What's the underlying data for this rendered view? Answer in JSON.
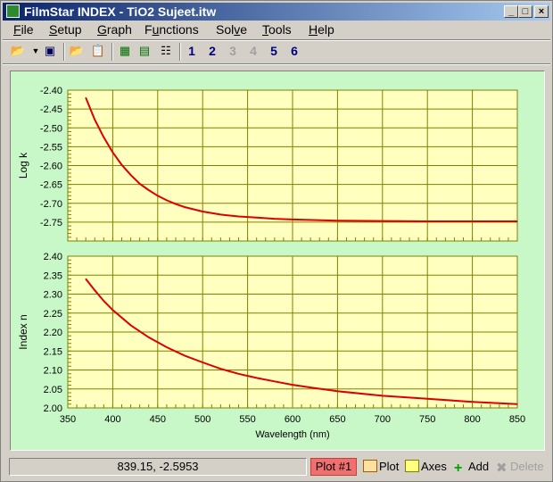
{
  "window": {
    "title": "FilmStar INDEX - TiO2 Sujeet.itw"
  },
  "menu": [
    "File",
    "Setup",
    "Graph",
    "Functions",
    "Solve",
    "Tools",
    "Help"
  ],
  "menu_underline": [
    "F",
    "S",
    "G",
    "u",
    "v",
    "T",
    "H"
  ],
  "toolbar": {
    "numbers": [
      "1",
      "2",
      "3",
      "4",
      "5",
      "6"
    ],
    "disabled_numbers": [
      "3",
      "4"
    ]
  },
  "status": {
    "coords": "839.15, -2.5953",
    "plot_badge": "Plot #1",
    "plot_label": "Plot",
    "axes_label": "Axes",
    "add_label": "Add",
    "delete_label": "Delete"
  },
  "colors": {
    "plot_bg": "#ffffc0",
    "grid": "#808000",
    "curve": "#dd0000",
    "frame_bg": "#c8f8c8"
  },
  "chart_data": [
    {
      "type": "line",
      "ylabel": "Log k",
      "xlim": [
        350,
        850
      ],
      "ylim": [
        -2.8,
        -2.4
      ],
      "yticks": [
        "-2.40",
        "-2.45",
        "-2.50",
        "-2.55",
        "-2.60",
        "-2.65",
        "-2.70",
        "-2.75"
      ],
      "x": [
        370,
        380,
        390,
        400,
        410,
        420,
        430,
        440,
        450,
        460,
        470,
        480,
        490,
        500,
        520,
        540,
        560,
        580,
        600,
        650,
        700,
        750,
        800,
        850
      ],
      "y": [
        -2.42,
        -2.478,
        -2.525,
        -2.565,
        -2.598,
        -2.625,
        -2.648,
        -2.665,
        -2.68,
        -2.692,
        -2.702,
        -2.71,
        -2.716,
        -2.722,
        -2.73,
        -2.735,
        -2.738,
        -2.741,
        -2.743,
        -2.746,
        -2.747,
        -2.748,
        -2.748,
        -2.748
      ]
    },
    {
      "type": "line",
      "ylabel": "Index n",
      "xlabel": "Wavelength (nm)",
      "xlim": [
        350,
        850
      ],
      "ylim": [
        2.0,
        2.4
      ],
      "yticks": [
        "2.40",
        "2.35",
        "2.30",
        "2.25",
        "2.20",
        "2.15",
        "2.10",
        "2.05",
        "2.00"
      ],
      "xticks": [
        "350",
        "400",
        "450",
        "500",
        "550",
        "600",
        "650",
        "700",
        "750",
        "800",
        "850"
      ],
      "x": [
        370,
        380,
        390,
        400,
        420,
        440,
        460,
        480,
        500,
        520,
        540,
        560,
        580,
        600,
        620,
        650,
        700,
        750,
        800,
        850
      ],
      "y": [
        2.34,
        2.31,
        2.282,
        2.258,
        2.218,
        2.186,
        2.16,
        2.138,
        2.12,
        2.103,
        2.09,
        2.079,
        2.07,
        2.061,
        2.054,
        2.044,
        2.032,
        2.024,
        2.016,
        2.01
      ]
    }
  ]
}
